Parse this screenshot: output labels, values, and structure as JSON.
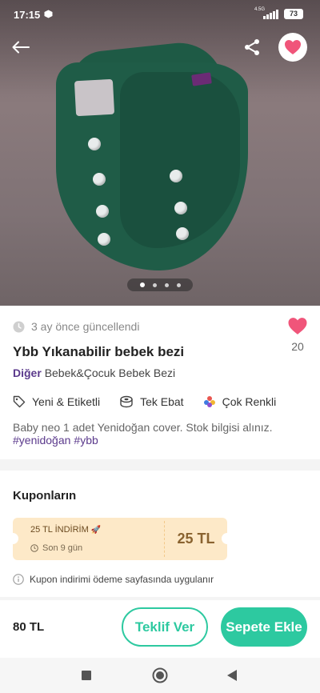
{
  "status_bar": {
    "time": "17:15",
    "network": "4.5G",
    "battery": "73"
  },
  "hero": {
    "image_alt": "green cloth diaper cover",
    "slides_total": 4,
    "active_slide": 1,
    "favorited": true
  },
  "product": {
    "updated": "3 ay önce güncellendi",
    "likes": "20",
    "title": "Ybb Yıkanabilir bebek bezi",
    "category_main": "Diğer",
    "category_path": "Bebek&Çocuk Bebek Bezi",
    "attributes": [
      {
        "icon": "tag-icon",
        "label": "Yeni & Etiketli"
      },
      {
        "icon": "ruler-tape-icon",
        "label": "Tek Ebat"
      },
      {
        "icon": "multicolor-icon",
        "label": "Çok Renkli"
      }
    ],
    "description": "Baby neo 1 adet Yenidoğan cover. Stok bilgisi alınız.",
    "hashtags": [
      "#yenidoğan",
      "#ybb"
    ]
  },
  "coupons": {
    "title": "Kuponların",
    "items": [
      {
        "name": "25 TL İNDİRİM",
        "emoji": "🚀",
        "expires": "Son 9 gün",
        "amount": "25 TL"
      }
    ],
    "note": "Kupon indirimi ödeme sayfasında uygulanır"
  },
  "bottom_bar": {
    "price": "80 TL",
    "offer_label": "Teklif Ver",
    "cart_label": "Sepete Ekle"
  },
  "colors": {
    "accent": "#2dc9a0",
    "category": "#5b3a8c",
    "heart": "#f0557a",
    "coupon_bg": "#fde9c8"
  }
}
